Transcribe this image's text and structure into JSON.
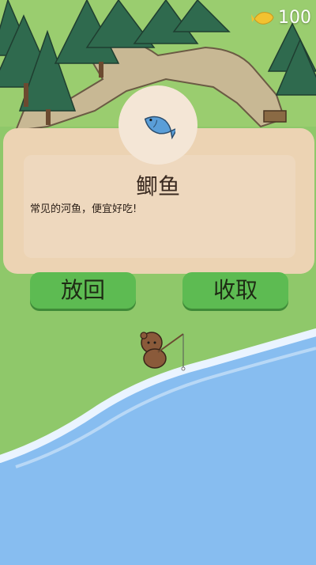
{
  "hud": {
    "coin_amount": "100"
  },
  "catch_card": {
    "fish_name": "鲫鱼",
    "description": "常见的河鱼，便宜好吃!"
  },
  "actions": {
    "release_label": "放回",
    "collect_label": "收取"
  },
  "colors": {
    "card": "#ecd3b3",
    "button": "#5dbb52",
    "grass": "#8fc86a",
    "water": "#87bdf0"
  }
}
